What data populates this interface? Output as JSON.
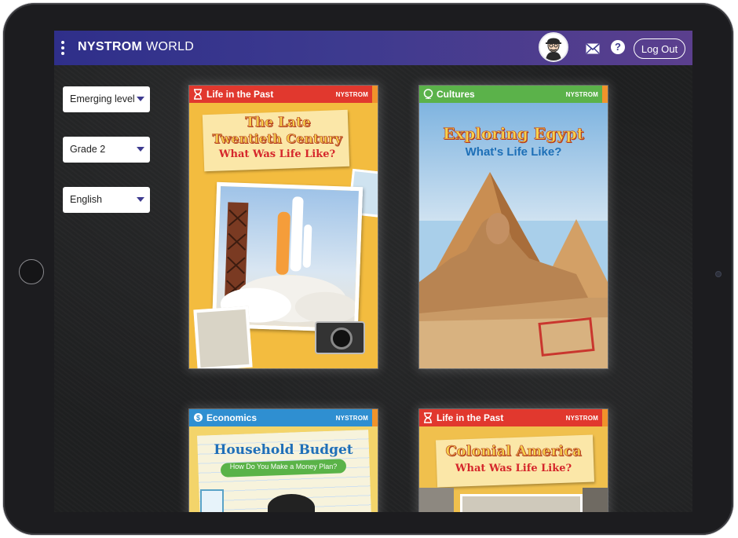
{
  "header": {
    "brand_bold": "NYSTROM",
    "brand_light": "WORLD",
    "logout_label": "Log Out",
    "help_glyph": "?",
    "icons": [
      "menu-dots-icon",
      "avatar-icon",
      "mail-icon",
      "help-icon"
    ]
  },
  "filters": {
    "level": "Emerging level",
    "grade": "Grade 2",
    "language": "English"
  },
  "books": [
    {
      "category": "Life in the Past",
      "publisher": "NYSTROM",
      "title_line1": "The Late",
      "title_line2": "Twentieth Century",
      "subtitle": "What Was Life Like?",
      "category_color": "#e1382e"
    },
    {
      "category": "Cultures",
      "publisher": "NYSTROM",
      "title_line1": "Exploring Egypt",
      "subtitle": "What's Life Like?",
      "category_color": "#5bb24a"
    },
    {
      "category": "Economics",
      "publisher": "NYSTROM",
      "title_line1": "Household Budget",
      "subtitle": "How Do You Make a Money Plan?",
      "category_color": "#2f8fd1"
    },
    {
      "category": "Life in the Past",
      "publisher": "NYSTROM",
      "title_line1": "Colonial America",
      "subtitle": "What Was Life Like?",
      "category_color": "#e1382e"
    }
  ],
  "colors": {
    "topbar_start": "#2f2f8a",
    "topbar_end": "#5b3f8e",
    "chevron": "#3d3a8f",
    "page_background": "#1f2021"
  }
}
